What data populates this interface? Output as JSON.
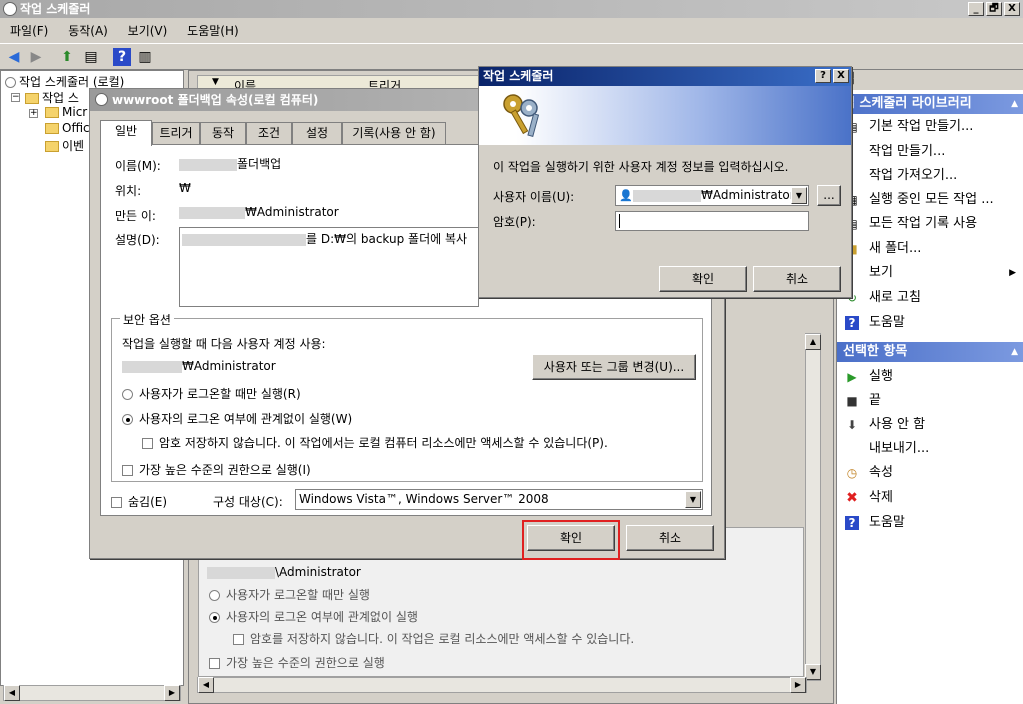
{
  "main_window": {
    "title": "작업 스케줄러",
    "controls": [
      "_",
      "🗗",
      "X"
    ]
  },
  "menu": [
    "파일(F)",
    "동작(A)",
    "보기(V)",
    "도움말(H)"
  ],
  "tree": {
    "root": "작업 스케줄러 (로컬)",
    "library": "작업 스",
    "children": [
      "Micr",
      "Offic",
      "이벤"
    ]
  },
  "center": {
    "columns": [
      "이름",
      "트리거"
    ],
    "lower": {
      "account_suffix": "\\Administrator",
      "radio_logon_only": "사용자가 로그온할 때만 실행",
      "radio_regardless": "사용자의 로그온 여부에 관계없이 실행",
      "check_no_password": "암호를 저장하지 않습니다. 이 작업은 로컬 리소스에만 액세스할 수 있습니다.",
      "check_highest": "가장 높은 수준의 권한으로 실행"
    }
  },
  "actions": {
    "header_partial": "업",
    "section_library": "업 스케줄러 라이브러리",
    "library_items": [
      "기본 작업 만들기...",
      "작업 만들기...",
      "작업 가져오기...",
      "실행 중인 모든 작업 ...",
      "모든 작업 기록 사용",
      "새 폴더...",
      "보기",
      "새로 고침",
      "도움말"
    ],
    "section_selected": "선택한 항목",
    "selected_items": [
      "실행",
      "끝",
      "사용 안 함",
      "내보내기...",
      "속성",
      "삭제",
      "도움말"
    ]
  },
  "props_dialog": {
    "title": "wwwroot 폴더백업 속성(로컬 컴퓨터)",
    "tabs": [
      "일반",
      "트리거",
      "동작",
      "조건",
      "설정",
      "기록(사용 안 함)"
    ],
    "name_label": "이름(M):",
    "name_value": "폴더백업",
    "location_label": "위치:",
    "location_value": "₩",
    "author_label": "만든 이:",
    "author_value": "₩Administrator",
    "desc_label": "설명(D):",
    "desc_value": "를 D:₩의 backup 폴더에 복사",
    "security_group": "보안 옵션",
    "security_run_as": "작업을 실행할 때 다음 사용자 계정 사용:",
    "security_account": "₩Administrator",
    "change_user_button": "사용자 또는 그룹 변경(U)...",
    "radio_logon_only": "사용자가 로그온할 때만 실행(R)",
    "radio_regardless": "사용자의 로그온 여부에 관계없이 실행(W)",
    "check_no_password": "암호 저장하지 않습니다. 이 작업에서는 로컬 컴퓨터 리소스에만 액세스할 수 있습니다(P).",
    "check_highest": "가장 높은 수준의 권한으로 실행(I)",
    "hidden_label": "숨김(E)",
    "configure_label": "구성 대상(C):",
    "configure_value": "Windows Vista™, Windows Server™ 2008",
    "ok": "확인",
    "cancel": "취소"
  },
  "cred_dialog": {
    "title": "작업 스케줄러",
    "help": "?",
    "close": "X",
    "prompt": "이 작업을 실행하기 위한 사용자 계정 정보를 입력하십시오.",
    "user_label": "사용자 이름(U):",
    "user_value": "₩Administrator",
    "browse": "...",
    "password_label": "암호(P):",
    "ok": "확인",
    "cancel": "취소"
  },
  "colors": {
    "highlight": "#e02020",
    "active_title": "#0a246a",
    "actions_header": "#4a6fc8"
  }
}
